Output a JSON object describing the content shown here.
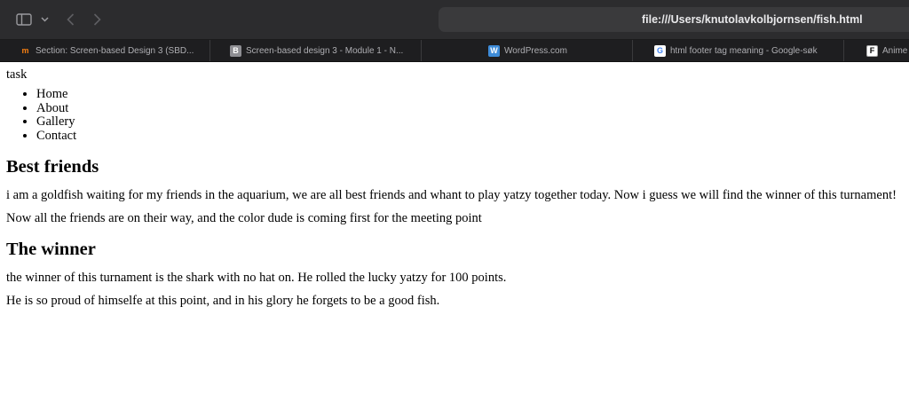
{
  "browser": {
    "address": "file:///Users/knutolavkolbjornsen/fish.html",
    "tabs": [
      {
        "icon": "moodle-icon",
        "label": "Section: Screen-based Design 3 (SBD..."
      },
      {
        "icon": "b-icon",
        "label": "Screen-based design 3 - Module 1 - N..."
      },
      {
        "icon": "wordpress-icon",
        "label": "WordPress.com"
      },
      {
        "icon": "google-icon",
        "label": "html footer tag meaning - Google-søk"
      },
      {
        "icon": "f-icon",
        "label": "Anime"
      }
    ]
  },
  "page": {
    "task_label": "task",
    "nav": [
      "Home",
      "About",
      "Gallery",
      "Contact"
    ],
    "section1": {
      "heading": "Best friends",
      "p1": "i am a goldfish waiting for my friends in the aquarium, we are all best friends and whant to play yatzy together today. Now i guess we will find the winner of this turnament!",
      "p2": "Now all the friends are on their way, and the color dude is coming first for the meeting point"
    },
    "section2": {
      "heading": "The winner",
      "p1": "the winner of this turnament is the shark with no hat on. He rolled the lucky yatzy for 100 points.",
      "p2": "He is so proud of himselfe at this point, and in his glory he forgets to be a good fish."
    }
  }
}
